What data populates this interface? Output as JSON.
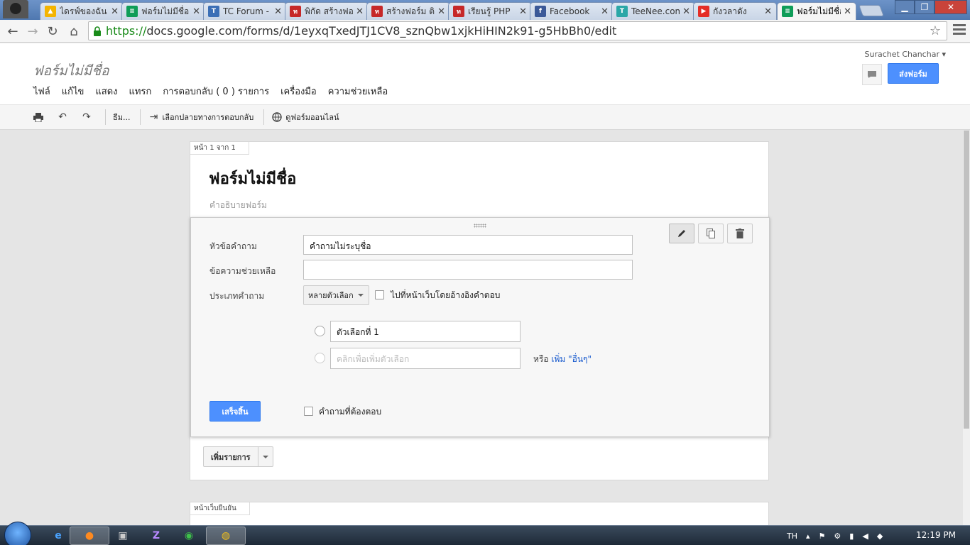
{
  "browser": {
    "tabs": [
      {
        "label": "ไดรฟ์ของฉัน",
        "icon": "google-drive-icon",
        "color": "#f4b400"
      },
      {
        "label": "ฟอร์มไม่มีชื่อ",
        "icon": "google-forms-icon",
        "color": "#0f9d58"
      },
      {
        "label": "TC Forum -",
        "icon": "tc-forum-icon",
        "color": "#3b6fb6"
      },
      {
        "label": "พิกัด สร้างฟอ",
        "icon": "red-site-icon",
        "color": "#c62828"
      },
      {
        "label": "สร้างฟอร์ม ติ",
        "icon": "red-site-icon",
        "color": "#c62828"
      },
      {
        "label": "เรียนรู้ PHP",
        "icon": "red-site-icon",
        "color": "#c62828"
      },
      {
        "label": "Facebook",
        "icon": "facebook-icon",
        "color": "#3b5998"
      },
      {
        "label": "TeeNee.com",
        "icon": "teenee-icon",
        "color": "#2aa7a7"
      },
      {
        "label": "กังวลาดัง",
        "icon": "youtube-icon",
        "color": "#e52d27"
      },
      {
        "label": "ฟอร์มไม่มีชื่อ",
        "icon": "google-forms-icon",
        "color": "#0f9d58"
      }
    ],
    "url_scheme": "https://",
    "url_rest": "docs.google.com/forms/d/1eyxqTxedJTJ1CV8_sznQbw1xjkHiHIN2k91-g5HbBh0/edit"
  },
  "docs": {
    "title": "ฟอร์มไม่มีชื่อ",
    "account": "Surachet Chanchar",
    "send_label": "ส่งฟอร์ม",
    "menu": [
      "ไฟล์",
      "แก้ไข",
      "แสดง",
      "แทรก",
      "การตอบกลับ ( 0 ) รายการ",
      "เครื่องมือ",
      "ความช่วยเหลือ"
    ],
    "toolbar": {
      "theme": "ธีม...",
      "destination": "เลือกปลายทางการตอบกลับ",
      "view_live": "ดูฟอร์มออนไลน์"
    }
  },
  "form": {
    "page_tag": "หน้า 1 จาก 1",
    "title": "ฟอร์มไม่มีชื่อ",
    "description": "คำอธิบายฟอร์ม",
    "question": {
      "title_label": "หัวข้อคำถาม",
      "title_value": "คำถามไม่ระบุชื่อ",
      "help_label": "ข้อความช่วยเหลือ",
      "help_value": "",
      "type_label": "ประเภทคำถาม",
      "type_value": "หลายตัวเลือก",
      "goto_label": "ไปที่หน้าเว็บโดยอ้างอิงคำตอบ",
      "option1": "ตัวเลือกที่ 1",
      "add_option_placeholder": "คลิกเพื่อเพิ่มตัวเลือก",
      "or_text": "หรือ",
      "add_other": "เพิ่ม \"อื่นๆ\"",
      "done_label": "เสร็จสิ้น",
      "required_label": "คำถามที่ต้องตอบ"
    },
    "add_item_label": "เพิ่มรายการ",
    "confirm_tag": "หน้าเว็บยืนยัน"
  },
  "taskbar": {
    "lang": "TH",
    "clock": "12:19 PM"
  }
}
